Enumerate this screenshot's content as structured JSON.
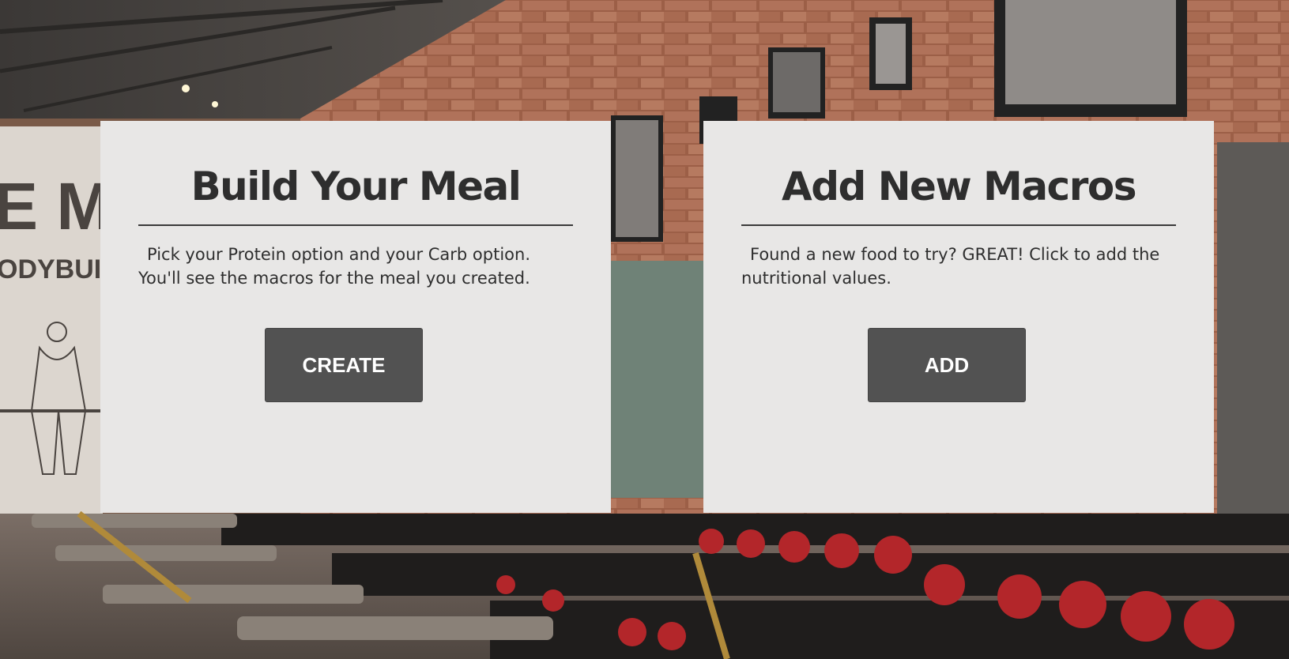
{
  "cards": [
    {
      "title": "Build Your Meal",
      "description": "Pick your Protein option and your Carb option. You'll see the macros for the meal you created.",
      "button_label": "CREATE"
    },
    {
      "title": "Add New Macros",
      "description": "Found a new food to try? GREAT! Click to add the nutritional values.",
      "button_label": "ADD"
    }
  ],
  "background": {
    "description_icon": "gym-photo",
    "wall_colors": [
      "#a4674d",
      "#8e5640"
    ],
    "card_color": "#e8e7e6",
    "button_color": "#525252",
    "text_color": "#2e2e2e"
  }
}
